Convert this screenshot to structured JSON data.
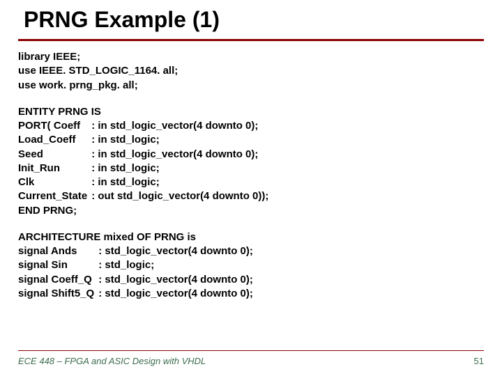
{
  "title": "PRNG Example (1)",
  "libs": [
    "library IEEE;",
    "use IEEE. STD_LOGIC_1164. all;",
    "use work. prng_pkg. all;"
  ],
  "entity": {
    "open": "ENTITY PRNG IS",
    "port_kw": "PORT( ",
    "ports": [
      {
        "name": "Coeff",
        "type": ": in  std_logic_vector(4 downto 0);"
      },
      {
        "name": "Load_Coeff",
        "type": ": in  std_logic;"
      },
      {
        "name": "Seed",
        "type": ": in  std_logic_vector(4 downto 0);"
      },
      {
        "name": "Init_Run",
        "type": ": in  std_logic;"
      },
      {
        "name": "Clk",
        "type": ": in  std_logic;"
      },
      {
        "name": "Current_State",
        "type": ": out std_logic_vector(4 downto 0));"
      }
    ],
    "close": "END PRNG;"
  },
  "arch": {
    "open": "ARCHITECTURE mixed OF PRNG is",
    "sig_kw": "signal ",
    "signals": [
      {
        "name": "Ands",
        "type": ": std_logic_vector(4 downto 0);"
      },
      {
        "name": "Sin",
        "type": ": std_logic;"
      },
      {
        "name": "Coeff_Q",
        "type": ": std_logic_vector(4 downto 0);"
      },
      {
        "name": "Shift5_Q",
        "type": ": std_logic_vector(4 downto 0);"
      }
    ]
  },
  "footer": {
    "left": "ECE 448 – FPGA and ASIC Design with VHDL",
    "page": "51"
  }
}
